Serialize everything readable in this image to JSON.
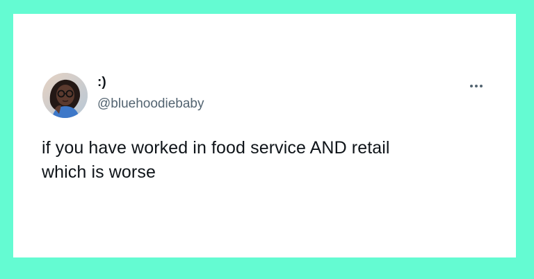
{
  "colors": {
    "background": "#64fbd2",
    "card": "#ffffff",
    "text_primary": "#0f1419",
    "text_secondary": "#536471"
  },
  "tweet": {
    "display_name": ":)",
    "handle": "@bluehoodiebaby",
    "text": "if you have worked in food service AND retail\nwhich is worse",
    "avatar_icon": "user-avatar-photo",
    "more_icon": "more-horizontal-icon"
  }
}
